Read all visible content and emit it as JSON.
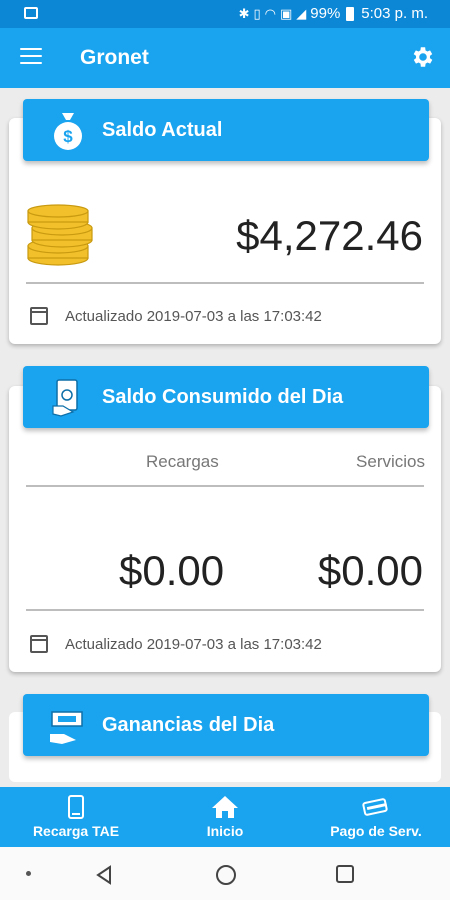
{
  "status_bar": {
    "battery": "99%",
    "time": "5:03 p. m."
  },
  "app_bar": {
    "title": "Gronet"
  },
  "saldo_actual": {
    "title": "Saldo Actual",
    "amount": "$4,272.46",
    "updated": "Actualizado 2019-07-03 a las 17:03:42"
  },
  "saldo_consumido": {
    "title": "Saldo Consumido del Dia",
    "recargas_label": "Recargas",
    "servicios_label": "Servicios",
    "recargas_amount": "$0.00",
    "servicios_amount": "$0.00",
    "updated": "Actualizado 2019-07-03 a las 17:03:42"
  },
  "ganancias": {
    "title": "Ganancias del Dia"
  },
  "bottom_nav": [
    {
      "label": "Recarga TAE",
      "icon": "phone-icon"
    },
    {
      "label": "Inicio",
      "icon": "home-icon"
    },
    {
      "label": "Pago de Serv.",
      "icon": "card-icon"
    }
  ],
  "colors": {
    "primary": "#1aa3ee",
    "status_bar": "#0c87d6",
    "coin": "#f2c02a"
  }
}
